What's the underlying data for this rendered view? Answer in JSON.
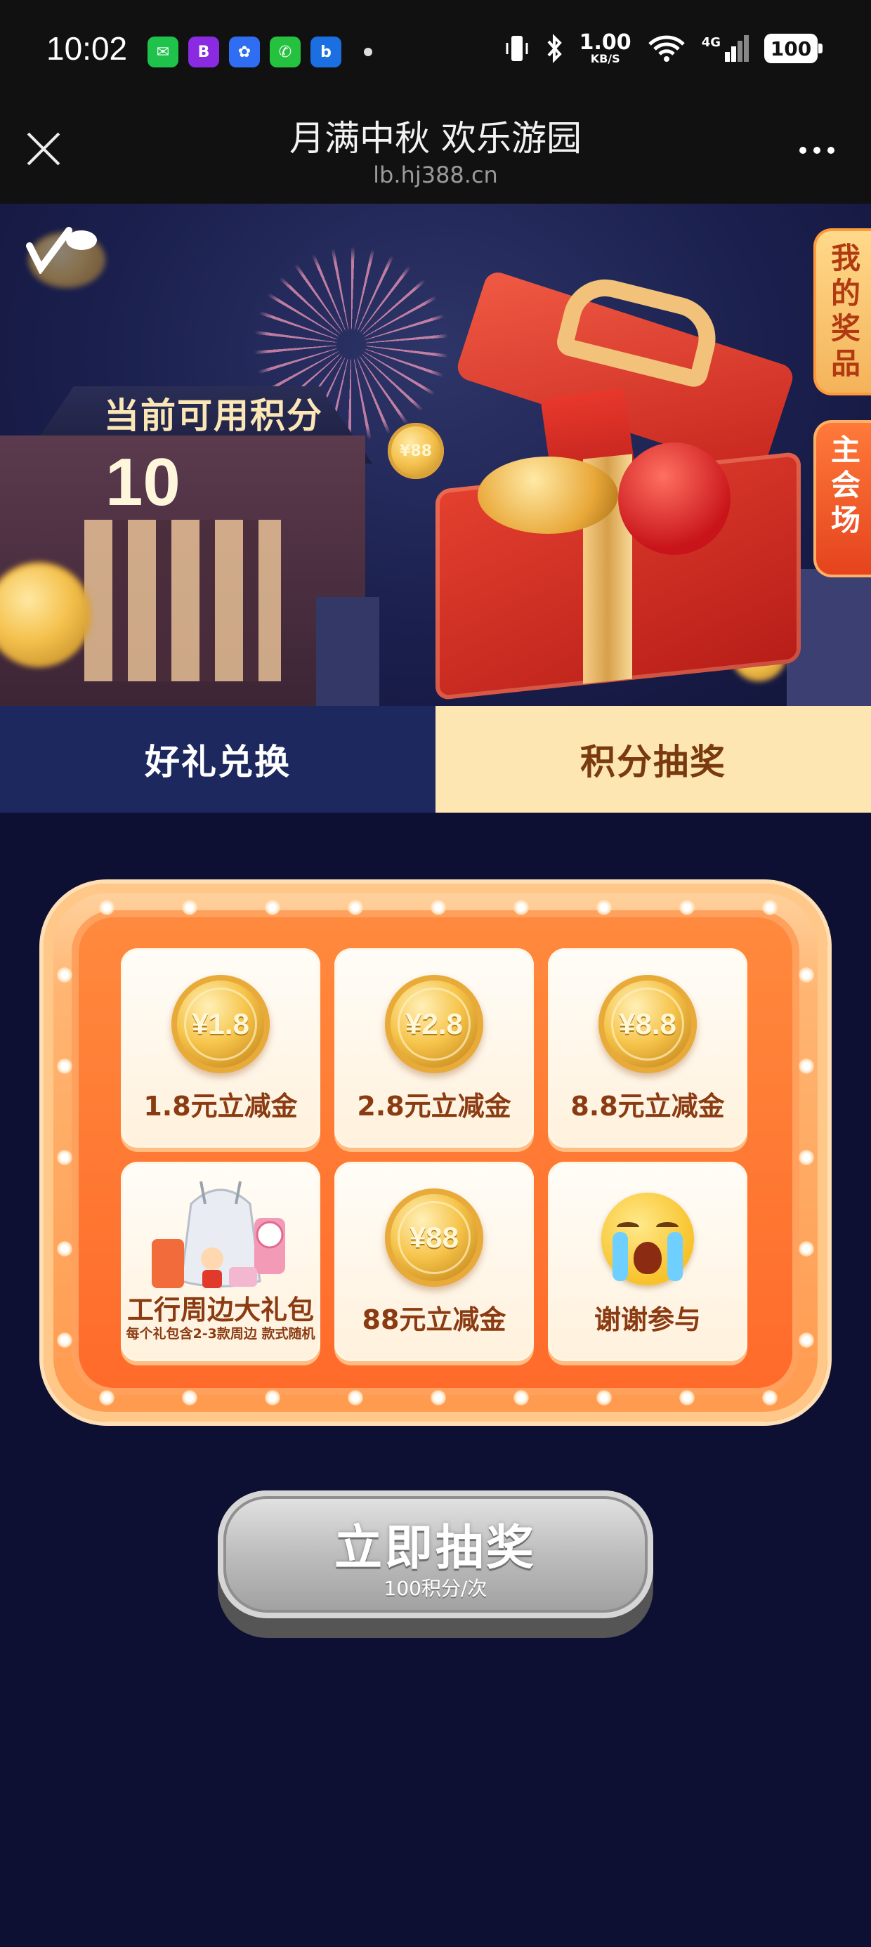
{
  "status_bar": {
    "time": "10:02",
    "apps": [
      {
        "icon": "wechat-icon",
        "color": "#1fc24a",
        "glyph": "✉"
      },
      {
        "icon": "bank-app-icon",
        "color": "#8a2be2",
        "glyph": "B"
      },
      {
        "icon": "baidu-icon",
        "color": "#2f6df2",
        "glyph": "✿"
      },
      {
        "icon": "phone-icon",
        "color": "#25c23f",
        "glyph": "✆"
      },
      {
        "icon": "browser-icon",
        "color": "#1b6fe0",
        "glyph": "b"
      }
    ],
    "net_speed": "1.00",
    "net_unit": "KB/S",
    "network": "4G",
    "battery": "100"
  },
  "titlebar": {
    "title": "月满中秋 欢乐游园",
    "url": "lb.hj388.cn"
  },
  "banner": {
    "points_label": "当前可用积分",
    "points_value": "10",
    "coin_text": "¥88"
  },
  "side_tabs": {
    "my_prizes": "我的奖品",
    "main_venue": "主会场"
  },
  "tabs": [
    {
      "label": "好礼兑换",
      "active": false
    },
    {
      "label": "积分抽奖",
      "active": true
    }
  ],
  "prizes": [
    {
      "type": "coin",
      "coin": "¥1.8",
      "label": "1.8元立减金"
    },
    {
      "type": "coin",
      "coin": "¥2.8",
      "label": "2.8元立减金"
    },
    {
      "type": "coin",
      "coin": "¥8.8",
      "label": "8.8元立减金"
    },
    {
      "type": "gift",
      "label": "工行周边大礼包",
      "sub": "每个礼包含2-3款周边 款式随机"
    },
    {
      "type": "coin",
      "coin": "¥88",
      "label": "88元立减金"
    },
    {
      "type": "emoji",
      "label": "谢谢参与"
    }
  ],
  "draw_button": {
    "label": "立即抽奖",
    "cost": "100积分/次"
  },
  "colors": {
    "page_bg": "#0d1033",
    "tab_active_bg": "#fde6b1",
    "tab_inactive_bg": "#1d285f",
    "board_orange": "#ff7a32",
    "prize_text": "#8a3b12"
  }
}
